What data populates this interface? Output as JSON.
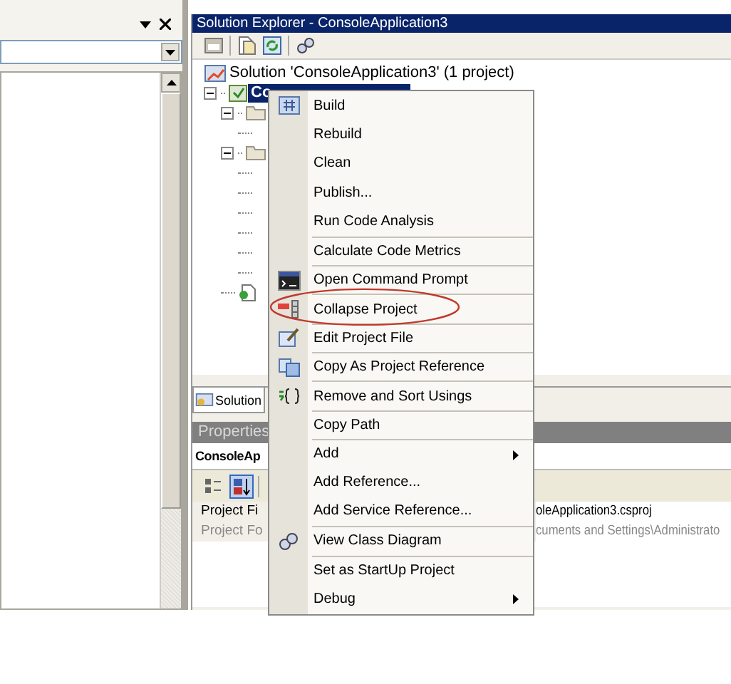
{
  "solution_explorer": {
    "title": "Solution Explorer - ConsoleApplication3",
    "toolbar": [
      {
        "kind": "properties"
      },
      {
        "kind": "show-files"
      },
      {
        "kind": "refresh"
      },
      {
        "kind": "class-view"
      }
    ],
    "tree": [
      {
        "kind": "solution",
        "label": "Solution 'ConsoleApplication3' (1 project)",
        "selected": false
      },
      {
        "kind": "project",
        "label": "Co",
        "selected": true,
        "expanded": true,
        "children": [
          {
            "kind": "folder",
            "expanded": true,
            "children": [
              {
                "kind": "leaf"
              }
            ]
          },
          {
            "kind": "folder",
            "expanded": true,
            "children": [
              {
                "kind": "leaf"
              },
              {
                "kind": "leaf"
              },
              {
                "kind": "leaf"
              },
              {
                "kind": "leaf"
              },
              {
                "kind": "leaf"
              },
              {
                "kind": "leaf"
              }
            ]
          },
          {
            "kind": "file"
          }
        ]
      }
    ],
    "tabs": [
      {
        "label": "Solution",
        "selected": true
      }
    ]
  },
  "properties": {
    "title": "Properties",
    "object": "ConsoleAp",
    "toolbar": [
      {
        "kind": "categorized",
        "selected": false
      },
      {
        "kind": "alphabetical",
        "selected": true
      }
    ],
    "rows": [
      {
        "name": "Project Fi",
        "value": "oleApplication3.csproj",
        "disabled": false
      },
      {
        "name": "Project Fo",
        "value": "cuments and Settings\\Administrato",
        "disabled": true
      }
    ]
  },
  "context_menu": {
    "items": [
      {
        "label": "Build",
        "kind": "build",
        "separator_above": false,
        "submenu": false,
        "circled": false
      },
      {
        "label": "Rebuild",
        "kind": "plain",
        "separator_above": false,
        "submenu": false,
        "circled": false
      },
      {
        "label": "Clean",
        "kind": "plain",
        "separator_above": false,
        "submenu": false,
        "circled": false
      },
      {
        "label": "Publish...",
        "kind": "plain",
        "separator_above": false,
        "submenu": false,
        "circled": false
      },
      {
        "label": "Run Code Analysis",
        "kind": "plain",
        "separator_above": false,
        "submenu": false,
        "circled": false
      },
      {
        "label": "Calculate Code Metrics",
        "kind": "plain",
        "separator_above": true,
        "submenu": false,
        "circled": false
      },
      {
        "label": "Open Command Prompt",
        "kind": "console",
        "separator_above": true,
        "submenu": false,
        "circled": false
      },
      {
        "label": "Collapse Project",
        "kind": "collapse",
        "separator_above": true,
        "submenu": false,
        "circled": true
      },
      {
        "label": "Edit Project File",
        "kind": "edit",
        "separator_above": true,
        "submenu": false,
        "circled": false
      },
      {
        "label": "Copy As Project Reference",
        "kind": "copy",
        "separator_above": true,
        "submenu": false,
        "circled": false
      },
      {
        "label": "Remove and Sort Usings",
        "kind": "usings",
        "separator_above": true,
        "submenu": false,
        "circled": false
      },
      {
        "label": "Copy Path",
        "kind": "plain",
        "separator_above": true,
        "submenu": false,
        "circled": false
      },
      {
        "label": "Add",
        "kind": "plain",
        "separator_above": true,
        "submenu": true,
        "circled": false
      },
      {
        "label": "Add Reference...",
        "kind": "plain",
        "separator_above": false,
        "submenu": false,
        "circled": false
      },
      {
        "label": "Add Service Reference...",
        "kind": "plain",
        "separator_above": false,
        "submenu": false,
        "circled": false
      },
      {
        "label": "View Class Diagram",
        "kind": "diagram",
        "separator_above": true,
        "submenu": false,
        "circled": false
      },
      {
        "label": "Set as StartUp Project",
        "kind": "plain",
        "separator_above": true,
        "submenu": false,
        "circled": false
      },
      {
        "label": "Debug",
        "kind": "plain",
        "separator_above": false,
        "submenu": true,
        "circled": false
      }
    ]
  }
}
